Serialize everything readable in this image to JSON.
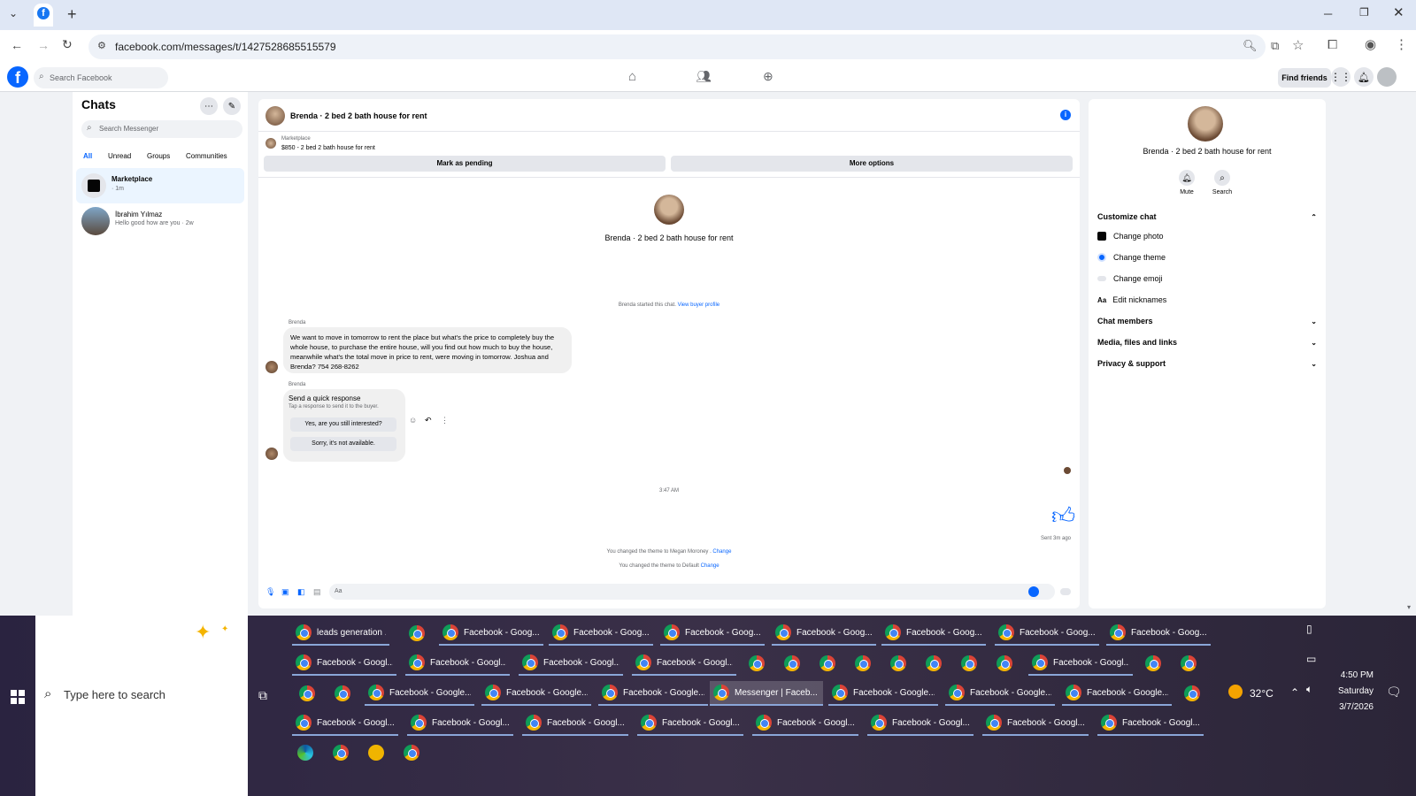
{
  "browser": {
    "url": "facebook.com/messages/t/1427528685515579",
    "new_tab": "+"
  },
  "fb": {
    "search_placeholder": "Search Facebook",
    "find_friends": "Find friends"
  },
  "chats": {
    "title": "Chats",
    "search_placeholder": "Search Messenger",
    "filters": [
      "All",
      "Unread",
      "Groups",
      "Communities"
    ],
    "items": [
      {
        "name": "Marketplace",
        "preview": "· 1m"
      },
      {
        "name": "İbrahim Yılmaz",
        "preview": "Hello good how are you · 2w"
      }
    ]
  },
  "conversation": {
    "header": "Brenda · 2 bed 2 bath house for rent",
    "marketplace_label": "Marketplace",
    "listing": "$850 - 2 bed 2 bath house for rent",
    "mark_pending": "Mark as pending",
    "more_options": "More options",
    "profile_name": "Brenda · 2 bed 2 bath house for rent",
    "started_text": "Brenda started this chat.",
    "view_profile": "View buyer profile",
    "sender1": "Brenda",
    "message1": "We want to move in tomorrow to rent the place but what's the price to completely buy the whole house, to purchase the entire house, will you find out how much to buy the house, meanwhile what's the total move in price to rent, were moving in tomorrow. Joshua and Brenda? 754 268-8262",
    "sender2": "Brenda",
    "quick_title": "Send a quick response",
    "quick_sub": "Tap a response to send it to the buyer.",
    "quick1": "Yes, are you still interested?",
    "quick2": "Sorry, it's not available.",
    "time": "3:47 AM",
    "sent": "Sent 3m ago",
    "theme1": "You changed the theme to Megan Moroney .",
    "theme2": "You changed the theme to Default",
    "change": "Change",
    "input_placeholder": "Aa"
  },
  "details": {
    "name": "Brenda · 2 bed 2 bath house for rent",
    "mute": "Mute",
    "search": "Search",
    "customize": "Customize chat",
    "change_photo": "Change photo",
    "change_theme": "Change theme",
    "change_emoji": "Change emoji",
    "edit_nicknames": "Edit nicknames",
    "aa": "Aa",
    "chat_members": "Chat members",
    "media": "Media, files and links",
    "privacy": "Privacy & support"
  },
  "taskbar": {
    "search": "Type here to search",
    "row1": [
      "leads generation ...",
      "",
      "Facebook - Goog...",
      "Facebook - Goog...",
      "Facebook - Goog...",
      "Facebook - Goog...",
      "Facebook - Goog...",
      "Facebook - Goog...",
      "Facebook - Goog..."
    ],
    "row2": [
      "Facebook - Googl...",
      "Facebook - Googl...",
      "Facebook - Googl...",
      "Facebook - Googl...",
      "",
      "",
      "",
      "",
      "",
      "",
      "",
      "",
      "Facebook - Googl...",
      "",
      ""
    ],
    "row3": [
      "",
      "",
      "Facebook - Google...",
      "Facebook - Google...",
      "Facebook - Google...",
      "Messenger | Faceb...",
      "Facebook - Google...",
      "Facebook - Google...",
      "Facebook - Google...",
      ""
    ],
    "row4": [
      "Facebook - Googl...",
      "Facebook - Googl...",
      "Facebook - Googl...",
      "Facebook - Googl...",
      "Facebook - Googl...",
      "Facebook - Googl...",
      "Facebook - Googl...",
      "Facebook - Googl..."
    ],
    "temp": "32°C",
    "clock": "4:50 PM",
    "day": "Saturday",
    "date": "3/7/2026"
  },
  "colors": {
    "accent": "#0866ff",
    "brand": "#1877f2"
  }
}
